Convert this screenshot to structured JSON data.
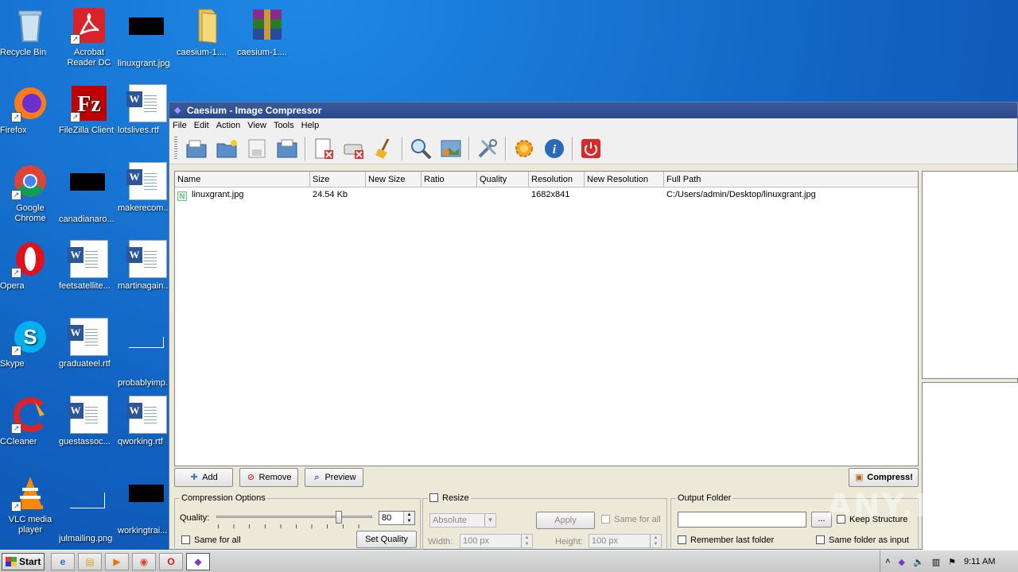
{
  "desktop": {
    "icons": [
      {
        "label": "Recycle Bin"
      },
      {
        "label": "Acrobat Reader DC"
      },
      {
        "label": "linuxgrant.jpg"
      },
      {
        "label": "caesium-1...."
      },
      {
        "label": "caesium-1...."
      },
      {
        "label": "Firefox"
      },
      {
        "label": "FileZilla Client"
      },
      {
        "label": "lotslives.rtf"
      },
      {
        "label": "Google Chrome"
      },
      {
        "label": "canadianaro..."
      },
      {
        "label": "makerecom..."
      },
      {
        "label": "Opera"
      },
      {
        "label": "feetsatellite..."
      },
      {
        "label": "martinagain..."
      },
      {
        "label": "Skype"
      },
      {
        "label": "graduateel.rtf"
      },
      {
        "label": "probablyimp..."
      },
      {
        "label": "CCleaner"
      },
      {
        "label": "guestassoc..."
      },
      {
        "label": "qworking.rtf"
      },
      {
        "label": "VLC media player"
      },
      {
        "label": "julmailing.png"
      },
      {
        "label": "workingtrai..."
      }
    ]
  },
  "window": {
    "title": "Caesium - Image Compressor",
    "menu": [
      "File",
      "Edit",
      "Action",
      "View",
      "Tools",
      "Help"
    ],
    "columns": [
      "Name",
      "Size",
      "New Size",
      "Ratio",
      "Quality",
      "Resolution",
      "New Resolution",
      "Full Path"
    ],
    "rows": [
      {
        "name": "linuxgrant.jpg",
        "size": "24.54 Kb",
        "new_size": "",
        "ratio": "",
        "quality": "",
        "resolution": "1682x841",
        "new_resolution": "",
        "full_path": "C:/Users/admin/Desktop/linuxgrant.jpg"
      }
    ],
    "buttons": {
      "add": "Add",
      "remove": "Remove",
      "preview": "Preview",
      "compress": "Compress!"
    },
    "compression": {
      "title": "Compression Options",
      "quality_label": "Quality:",
      "quality_value": "80",
      "same_for_all": "Same for all",
      "set_quality": "Set Quality"
    },
    "resize": {
      "title": "Resize",
      "mode": "Absolute",
      "apply": "Apply",
      "same_for_all": "Same for all",
      "width_label": "Width:",
      "width_value": "100 px",
      "height_label": "Height:",
      "height_value": "100 px"
    },
    "output": {
      "title": "Output Folder",
      "browse": "...",
      "keep_structure": "Keep Structure",
      "remember_last_folder": "Remember last folder",
      "same_folder_as_input": "Same folder as input"
    }
  },
  "taskbar": {
    "start": "Start",
    "clock": "9:11 AM"
  },
  "watermark": "ANY.RUN"
}
